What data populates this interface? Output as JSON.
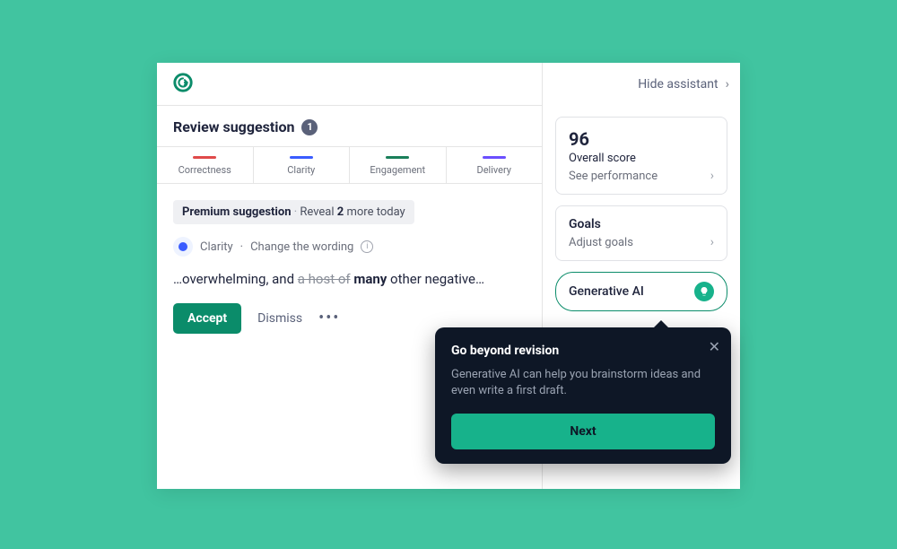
{
  "header": {
    "title": "Review suggestion",
    "count": "1"
  },
  "tabs": [
    {
      "label": "Correctness",
      "color": "red"
    },
    {
      "label": "Clarity",
      "color": "blue"
    },
    {
      "label": "Engagement",
      "color": "green"
    },
    {
      "label": "Delivery",
      "color": "purple"
    }
  ],
  "premium": {
    "prefix": "Premium suggestion",
    "sep": "·",
    "reveal_pre": "Reveal",
    "reveal_count": "2",
    "reveal_post": "more today"
  },
  "suggestion": {
    "category": "Clarity",
    "sep": "·",
    "action": "Change the wording"
  },
  "sentence": {
    "pre": "…overwhelming, and ",
    "strike": "a host of",
    "replacement": "many",
    "post": " other negative…"
  },
  "actions": {
    "accept": "Accept",
    "dismiss": "Dismiss"
  },
  "side": {
    "hide": "Hide assistant",
    "score_value": "96",
    "score_label": "Overall score",
    "score_link": "See performance",
    "goals_title": "Goals",
    "goals_link": "Adjust goals",
    "gen_label": "Generative AI"
  },
  "popover": {
    "title": "Go beyond revision",
    "body": "Generative AI can help you brainstorm ideas and even write a first draft.",
    "next": "Next"
  }
}
